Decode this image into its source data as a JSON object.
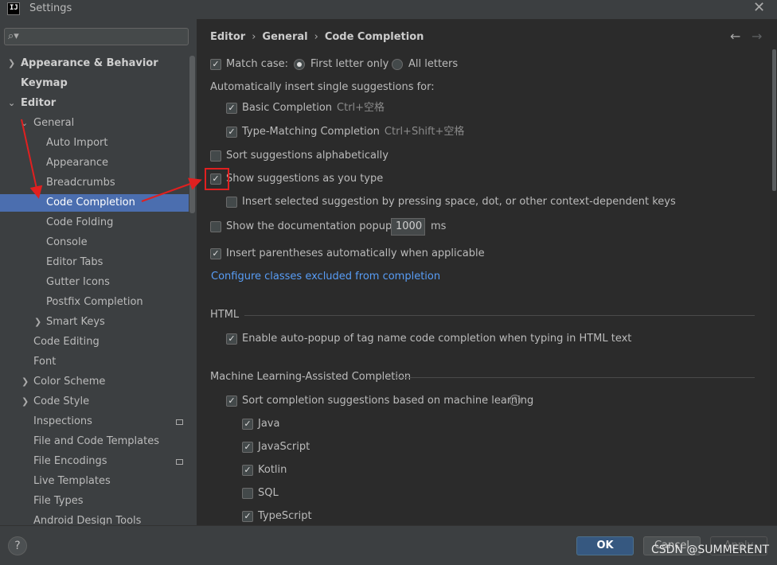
{
  "window": {
    "title": "Settings",
    "app_icon_text": "IJ"
  },
  "sidebar": {
    "search_placeholder": "",
    "items": [
      {
        "label": "Appearance & Behavior"
      },
      {
        "label": "Keymap"
      },
      {
        "label": "Editor"
      },
      {
        "label": "General"
      },
      {
        "label": "Auto Import"
      },
      {
        "label": "Appearance"
      },
      {
        "label": "Breadcrumbs"
      },
      {
        "label": "Code Completion"
      },
      {
        "label": "Code Folding"
      },
      {
        "label": "Console"
      },
      {
        "label": "Editor Tabs"
      },
      {
        "label": "Gutter Icons"
      },
      {
        "label": "Postfix Completion"
      },
      {
        "label": "Smart Keys"
      },
      {
        "label": "Code Editing"
      },
      {
        "label": "Font"
      },
      {
        "label": "Color Scheme"
      },
      {
        "label": "Code Style"
      },
      {
        "label": "Inspections"
      },
      {
        "label": "File and Code Templates"
      },
      {
        "label": "File Encodings"
      },
      {
        "label": "Live Templates"
      },
      {
        "label": "File Types"
      },
      {
        "label": "Android Design Tools"
      }
    ]
  },
  "breadcrumb": {
    "items": [
      "Editor",
      "General",
      "Code Completion"
    ]
  },
  "options": {
    "match_case": "Match case:",
    "first_letter_only": "First letter only",
    "all_letters": "All letters",
    "auto_insert_heading": "Automatically insert single suggestions for:",
    "basic_completion": "Basic Completion",
    "basic_completion_shortcut": "Ctrl+空格",
    "type_matching": "Type-Matching Completion",
    "type_matching_shortcut": "Ctrl+Shift+空格",
    "sort_alphabetically": "Sort suggestions alphabetically",
    "show_as_you_type": "Show suggestions as you type",
    "insert_selected": "Insert selected suggestion by pressing space, dot, or other context-dependent keys",
    "show_doc_popup": "Show the documentation popup in",
    "doc_popup_delay": "1000",
    "doc_popup_unit": "ms",
    "insert_parens": "Insert parentheses automatically when applicable",
    "configure_link": "Configure classes excluded from completion"
  },
  "html_section": {
    "title": "HTML",
    "enable_autopopup": "Enable auto-popup of tag name code completion when typing in HTML text"
  },
  "ml_section": {
    "title": "Machine Learning-Assisted Completion",
    "sort_ml": "Sort completion suggestions based on machine learning",
    "languages": [
      {
        "label": "Java",
        "checked": true
      },
      {
        "label": "JavaScript",
        "checked": true
      },
      {
        "label": "Kotlin",
        "checked": true
      },
      {
        "label": "SQL",
        "checked": false
      },
      {
        "label": "TypeScript",
        "checked": true
      }
    ]
  },
  "footer": {
    "help_label": "?",
    "ok_label": "OK",
    "cancel_label": "Cancel",
    "apply_label": "Apply"
  },
  "watermark": "CSDN @SUMMERENT",
  "colors": {
    "selection": "#4b6eaf",
    "link": "#589df6",
    "annotation": "#e02020"
  }
}
